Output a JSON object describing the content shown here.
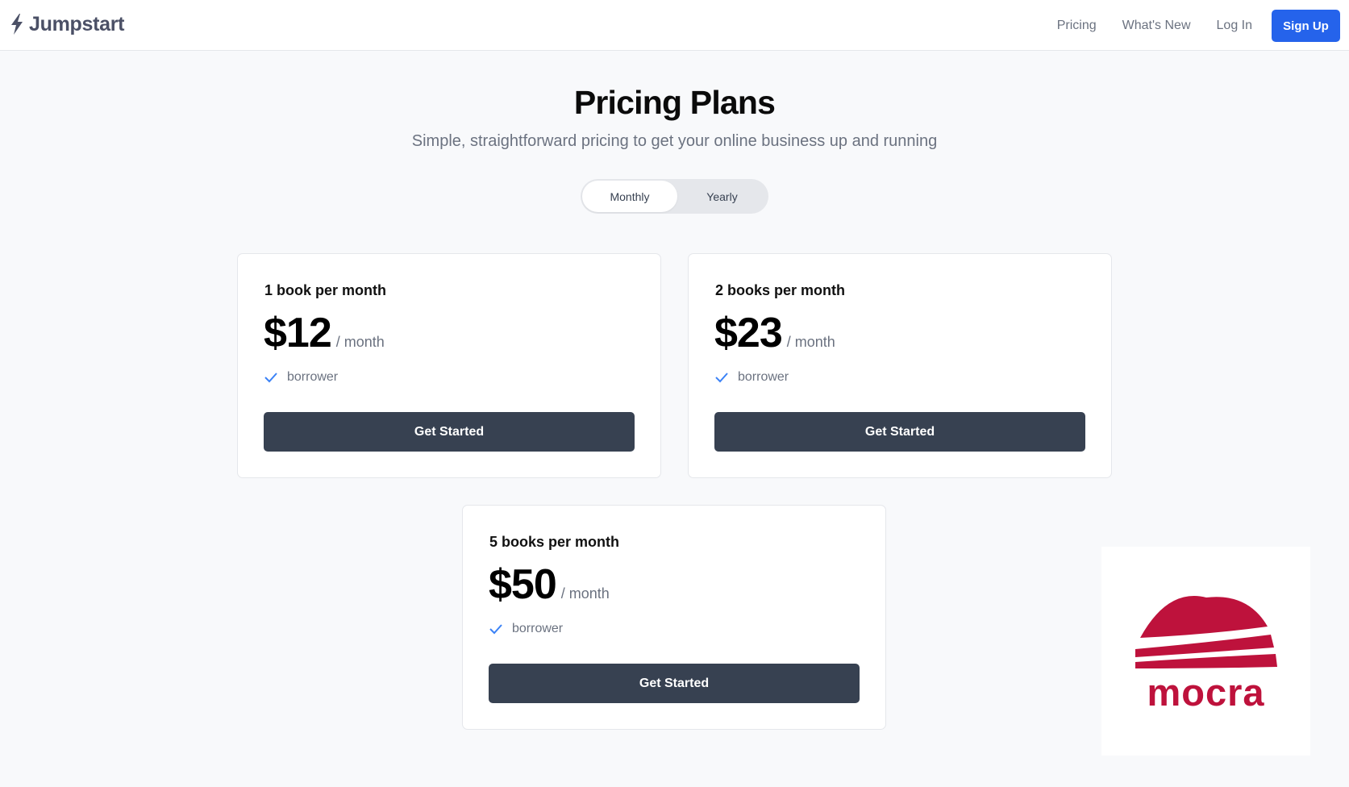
{
  "header": {
    "brand": "Jumpstart",
    "brand_icon": "lightning-bolt-icon",
    "nav": [
      {
        "label": "Pricing"
      },
      {
        "label": "What's New"
      },
      {
        "label": "Log In"
      }
    ],
    "signup_label": "Sign Up"
  },
  "hero": {
    "title": "Pricing Plans",
    "subtitle": "Simple, straightforward pricing to get your online business up and running"
  },
  "billing_toggle": {
    "options": [
      "Monthly",
      "Yearly"
    ],
    "selected": "Monthly"
  },
  "plans": [
    {
      "name": "1 book per month",
      "price": "$12",
      "period": "/ month",
      "features": [
        "borrower"
      ],
      "cta": "Get Started"
    },
    {
      "name": "2 books per month",
      "price": "$23",
      "period": "/ month",
      "features": [
        "borrower"
      ],
      "cta": "Get Started"
    },
    {
      "name": "5 books per month",
      "price": "$50",
      "period": "/ month",
      "features": [
        "borrower"
      ],
      "cta": "Get Started"
    }
  ],
  "badge": {
    "text": "mocra",
    "icon": "mocra-logo-icon",
    "color": "#be123c"
  },
  "colors": {
    "accent": "#2563eb",
    "button_dark": "#374151",
    "check": "#3b82f6"
  }
}
